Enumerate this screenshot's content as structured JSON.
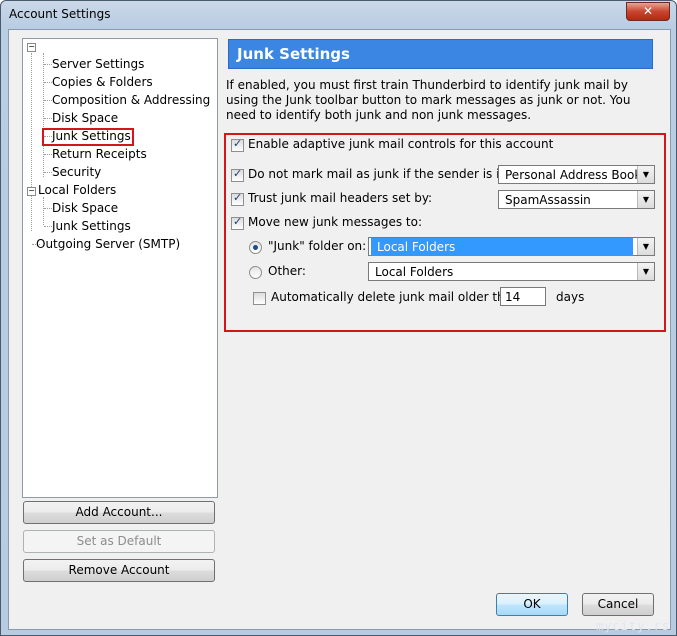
{
  "window": {
    "title": "Account Settings",
    "close_glyph": "✕"
  },
  "tree": {
    "root_expander": "−",
    "account_children": [
      "Server Settings",
      "Copies & Folders",
      "Composition & Addressing",
      "Disk Space",
      "Junk Settings",
      "Return Receipts",
      "Security"
    ],
    "local_folders": {
      "label": "Local Folders",
      "expander": "−",
      "children": [
        "Disk Space",
        "Junk Settings"
      ]
    },
    "outgoing": "Outgoing Server (SMTP)",
    "selected": "Junk Settings"
  },
  "left_buttons": {
    "add": "Add Account...",
    "default": "Set as Default",
    "remove": "Remove Account"
  },
  "panel": {
    "title": "Junk Settings",
    "description": "If enabled, you must first train Thunderbird to identify junk mail by using the Junk toolbar button to mark messages as junk or not. You need to identify both junk and non junk messages.",
    "enable_label": "Enable adaptive junk mail controls for this account",
    "dont_mark_label": "Do not mark mail as junk if the sender is in:",
    "address_book": "Personal Address Book",
    "trust_label": "Trust junk mail headers set by:",
    "trust_value": "SpamAssassin",
    "move_label": "Move new junk messages to:",
    "junk_folder_label": "\"Junk\" folder on:",
    "junk_folder_value": "Local Folders",
    "other_label": "Other:",
    "other_value": "Local Folders",
    "auto_delete_label": "Automatically delete junk mail older than",
    "auto_delete_days": "14",
    "days_label": "days",
    "checked_glyph": "✓",
    "arrow_glyph": "▼"
  },
  "dialog_buttons": {
    "ok": "OK",
    "cancel": "Cancel"
  },
  "watermark": "mycity.rs",
  "colors": {
    "highlight": "#d2161c",
    "header_blue": "#3a86e2",
    "selection_blue": "#3399ff"
  }
}
